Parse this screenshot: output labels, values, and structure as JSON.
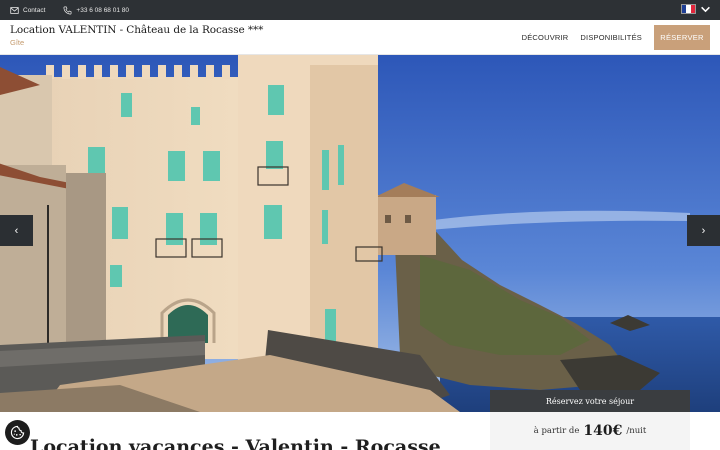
{
  "topbar": {
    "contact_label": "Contact",
    "phone": "+33 6 08 68 01 80",
    "language_icon": "flag-fr-icon"
  },
  "header": {
    "title": "Location VALENTIN - Château de la Rocasse ***",
    "subtitle": "Gîte",
    "nav": {
      "discover": "DÉCOUVRIR",
      "availability": "DISPONIBILITÉS",
      "reserve": "RÉSERVER"
    }
  },
  "hero": {
    "prev_icon": "‹",
    "next_icon": "›"
  },
  "booking": {
    "heading": "Réservez votre séjour",
    "from_label": "à partir de",
    "price": "140€",
    "per": "/nuit"
  },
  "page": {
    "title": "Location vacances - Valentin - Rocasse"
  },
  "colors": {
    "topbar": "#2d3135",
    "accent": "#c9a07a",
    "subtitle": "#c49a6c"
  }
}
